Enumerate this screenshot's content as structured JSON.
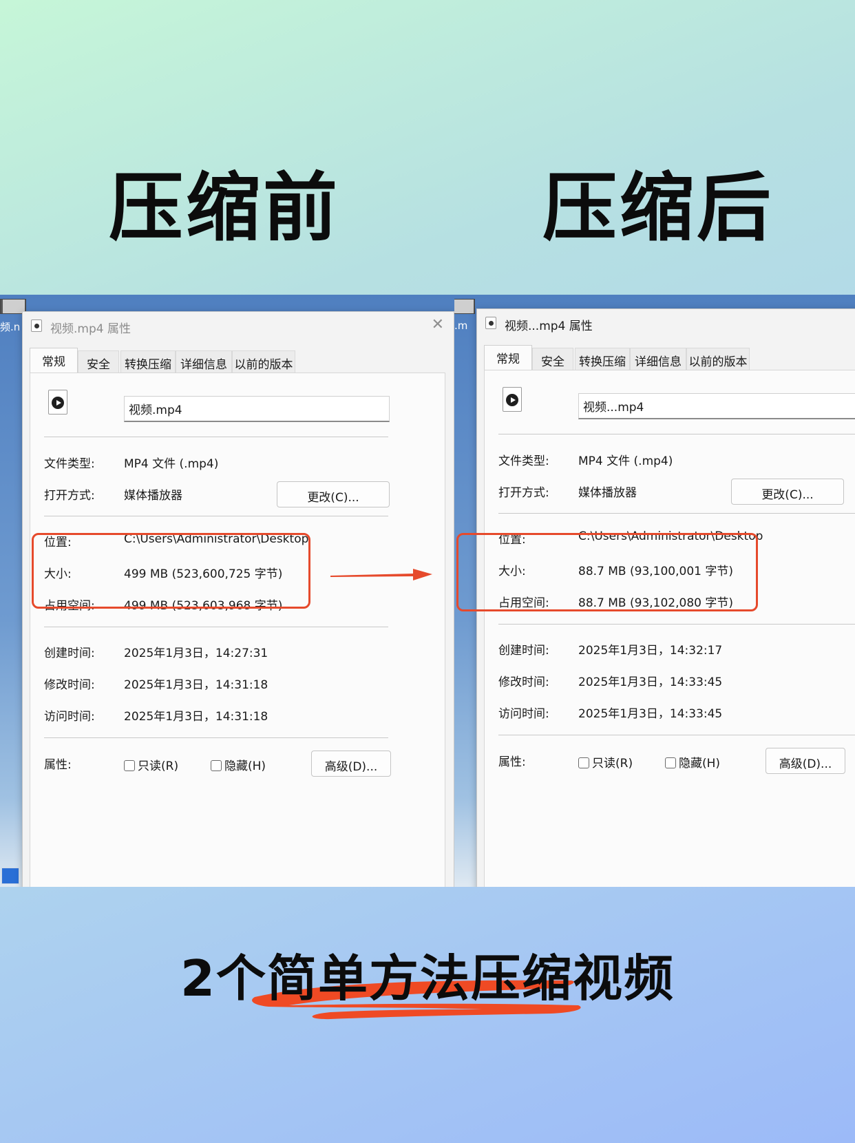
{
  "headings": {
    "before": "压缩前",
    "after": "压缩后"
  },
  "footer_title": "2个简单方法压缩视频",
  "desktop": {
    "left_label": "频.n",
    "right_label": ".m"
  },
  "tab_labels": [
    "常规",
    "安全",
    "转换压缩",
    "详细信息",
    "以前的版本"
  ],
  "labels": {
    "file_type": "文件类型:",
    "open_with": "打开方式:",
    "location": "位置:",
    "size": "大小:",
    "size_on_disk": "占用空间:",
    "created": "创建时间:",
    "modified": "修改时间:",
    "accessed": "访问时间:",
    "attributes": "属性:",
    "change_button": "更改(C)...",
    "readonly": "只读(R)",
    "hidden": "隐藏(H)",
    "advanced_button": "高级(D)..."
  },
  "before": {
    "title": "视频.mp4 属性",
    "filename": "视频.mp4",
    "file_type": "MP4 文件 (.mp4)",
    "open_with": "媒体播放器",
    "location": "C:\\Users\\Administrator\\Desktop",
    "size": "499 MB (523,600,725 字节)",
    "size_on_disk": "499 MB (523,603,968 字节)",
    "created": "2025年1月3日，14:27:31",
    "modified": "2025年1月3日，14:31:18",
    "accessed": "2025年1月3日，14:31:18"
  },
  "after": {
    "title": "视频...mp4 属性",
    "filename": "视频...mp4",
    "file_type": "MP4 文件 (.mp4)",
    "open_with": "媒体播放器",
    "location": "C:\\Users\\Administrator\\Desktop",
    "size": "88.7 MB (93,100,001 字节)",
    "size_on_disk": "88.7 MB (93,102,080 字节)",
    "created": "2025年1月3日，14:32:17",
    "modified": "2025年1月3日，14:33:45",
    "accessed": "2025年1月3日，14:33:45"
  },
  "colors": {
    "highlight": "#e64a2c",
    "dialog_bg": "#f3f3f3",
    "panel_bg": "#fbfbfb"
  }
}
